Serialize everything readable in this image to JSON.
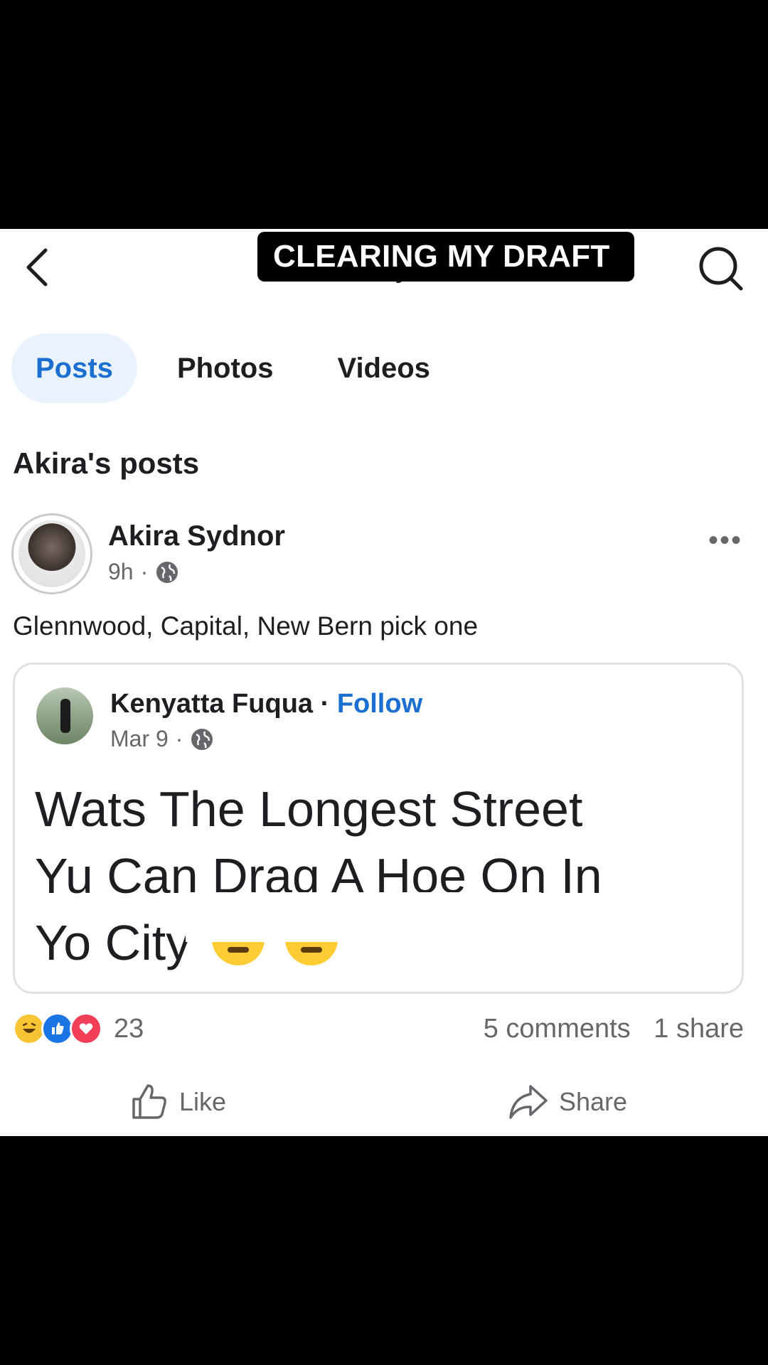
{
  "header": {
    "title": "Akira Sydnor",
    "back_icon": "chevron-left-icon",
    "search_icon": "search-icon"
  },
  "tabs": [
    {
      "label": "Posts",
      "active": true
    },
    {
      "label": "Photos",
      "active": false
    },
    {
      "label": "Videos",
      "active": false
    }
  ],
  "section_title": "Akira's posts",
  "caption_overlay": "CLEARING MY DRAFT",
  "post": {
    "author": "Akira Sydnor",
    "time": "9h",
    "separator": "·",
    "audience_icon": "globe-icon",
    "more_icon": "•••",
    "text": "Glennwood, Capital, New Bern pick one",
    "shared": {
      "author": "Kenyatta Fuqua",
      "separator": "·",
      "follow_label": "Follow",
      "date": "Mar 9",
      "body_line1": "Wats The Longest Street",
      "body_line2": "Yu Can Drag A Hoe On In",
      "body_line3": "Yo City"
    },
    "reaction_count": "23",
    "comments": "5 comments",
    "shares": "1 share",
    "actions": {
      "like_label": "Like",
      "share_label": "Share"
    }
  },
  "colors": {
    "accent": "#1b6fd1",
    "tab_active_bg": "#eaf3fd",
    "secondary_text": "#65676b"
  }
}
